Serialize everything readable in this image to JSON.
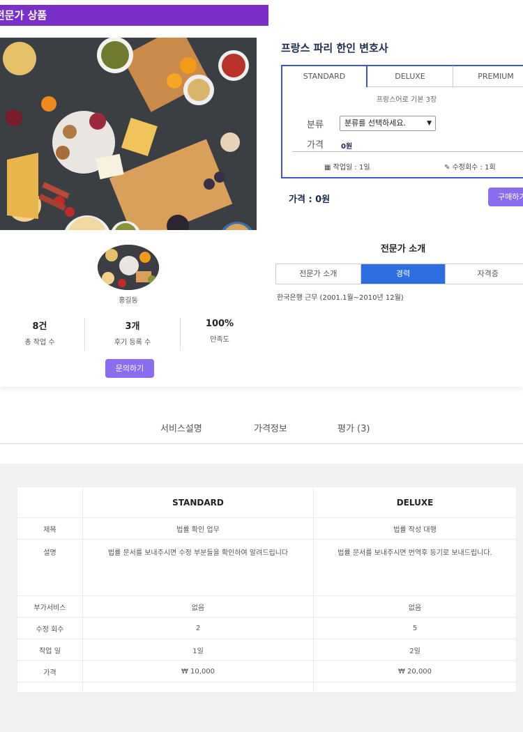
{
  "header": {
    "section_title": "전문가 상품"
  },
  "product": {
    "title": "프랑스 파리 한인 변호사",
    "tabs": [
      "STANDARD",
      "DELUXE",
      "PREMIUM"
    ],
    "active_tab": "STANDARD",
    "subtitle": "프랑스어로 기본 3장",
    "category_label": "분류",
    "category_select": "분류를 선택하세요.",
    "price_label": "가격",
    "price_value": "0원",
    "work_days": "작업일 : 1일",
    "revisions": "수정회수 : 1회",
    "total_price": "가격 : 0원",
    "buy_button": "구매하기"
  },
  "expert": {
    "name": "홍길동",
    "stats": [
      {
        "value": "8건",
        "label": "총 작업 수"
      },
      {
        "value": "3개",
        "label": "후기 등록 수"
      },
      {
        "value": "100%",
        "label": "만족도"
      }
    ],
    "contact_button": "문의하기",
    "intro_title": "전문가 소개",
    "intro_tabs": [
      "전문가 소개",
      "경력",
      "자격증"
    ],
    "active_intro_tab": "경력",
    "career": "한국은행 근무 (2001.1월~2010년 12월)"
  },
  "nav_tabs": [
    "서비스설명",
    "가격정보",
    "평가 (3)"
  ],
  "pricing_table": {
    "columns": [
      "STANDARD",
      "DELUXE"
    ],
    "rows": [
      {
        "label": "제목",
        "values": [
          "법률 확인 업무",
          "법률 작성 대행"
        ]
      },
      {
        "label": "설명",
        "values": [
          "법률 문서를 보내주시면 수정 부분들을 확인하여 알려드립니다",
          "법률 문서를 보내주시면 번역후 등기로 보내드립니다."
        ]
      },
      {
        "label": "부가서비스",
        "values": [
          "없음",
          "없음"
        ]
      },
      {
        "label": "수정 회수",
        "values": [
          "2",
          "5"
        ]
      },
      {
        "label": "작업 일",
        "values": [
          "1일",
          "2일"
        ]
      },
      {
        "label": "가격",
        "values": [
          "₩ 10,000",
          "₩ 20,000"
        ]
      }
    ]
  },
  "colors": {
    "accent": "#7b2fc9",
    "button": "#8a6cf0",
    "tab_blue": "#2d6fe0",
    "box_border": "#3f55c9"
  }
}
